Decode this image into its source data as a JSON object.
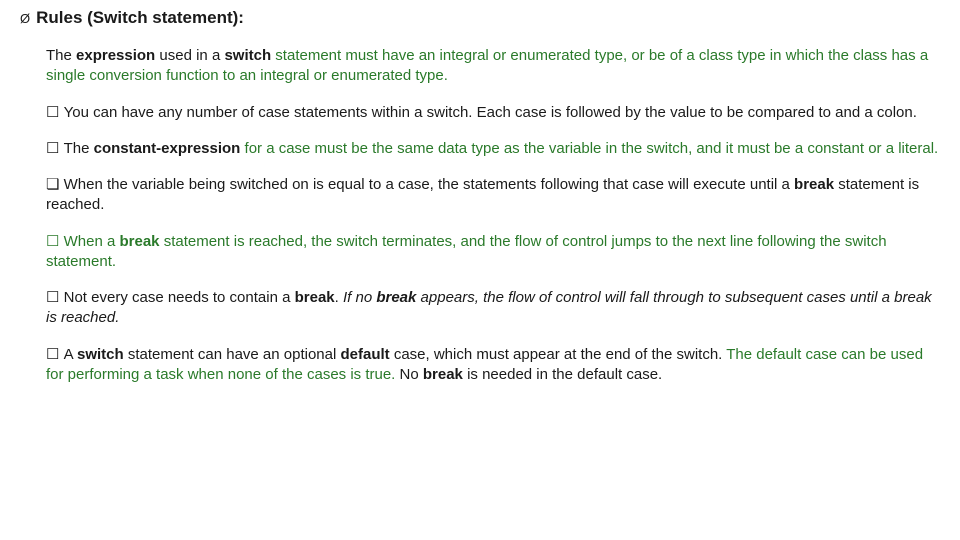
{
  "heading": {
    "bullet": "Ø",
    "text": "Rules (Switch statement):"
  },
  "rules": {
    "r1": {
      "p1": "The ",
      "p2": "expression",
      "p3": " used in a ",
      "p4": "switch",
      "p5": " statement must have an integral or enumerated type, or be of a class type in which the class has a single conversion function to an integral or enumerated type."
    },
    "r2": {
      "bullet": "☐ ",
      "text": "You can have any number of case statements within a switch. Each case is followed by the value to be compared to and a colon."
    },
    "r3": {
      "bullet": "☐ ",
      "p1": "The ",
      "p2": "constant-expression",
      "p3": " for a case must be the same data type as the variable in the switch, and it must be a constant or a literal."
    },
    "r4": {
      "bullet": "❏ ",
      "p1": "When the variable being switched on is equal to a case, the statements following that case will execute until a ",
      "p2": "break",
      "p3": " statement is reached."
    },
    "r5": {
      "bullet": "☐ ",
      "p1": "When a ",
      "p2": "break",
      "p3": " statement is reached, the switch terminates, and the flow of control jumps to the next line following the switch statement."
    },
    "r6": {
      "bullet": "☐ ",
      "p1": "Not every case needs to contain a ",
      "p2": "break",
      "p3": ". ",
      "p4": "If no ",
      "p5": "break",
      "p6": " appears, the flow of control will fall through to subsequent cases until a break is reached."
    },
    "r7": {
      "bullet": "☐ ",
      "p1": "A ",
      "p2": "switch",
      "p3": " statement can have an optional ",
      "p4": "default",
      "p5": " case, which must appear at the end of the switch. ",
      "p6": "The default case can be used for performing a task when none of the cases is true.",
      "p7": " No ",
      "p8": "break",
      "p9": " is needed in the default case."
    }
  }
}
